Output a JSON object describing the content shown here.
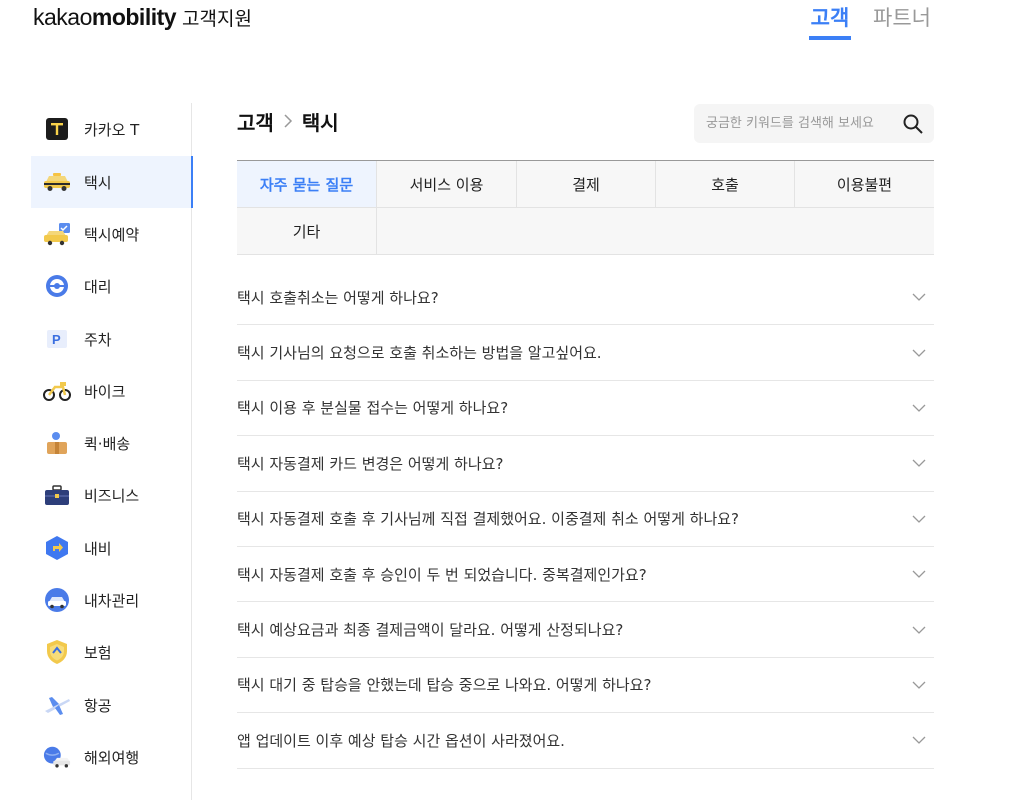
{
  "header": {
    "logo_kakao": "kakao",
    "logo_mobility": "mobility",
    "logo_support": "고객지원",
    "tabs": [
      {
        "label": "고객",
        "active": true
      },
      {
        "label": "파트너",
        "active": false
      }
    ]
  },
  "sidebar": {
    "items": [
      {
        "label": "카카오 T",
        "icon": "kakao-t-icon"
      },
      {
        "label": "택시",
        "icon": "taxi-icon",
        "active": true
      },
      {
        "label": "택시예약",
        "icon": "taxi-reservation-icon"
      },
      {
        "label": "대리",
        "icon": "designated-driver-icon"
      },
      {
        "label": "주차",
        "icon": "parking-icon"
      },
      {
        "label": "바이크",
        "icon": "bike-icon"
      },
      {
        "label": "퀵·배송",
        "icon": "quick-delivery-icon"
      },
      {
        "label": "비즈니스",
        "icon": "business-icon"
      },
      {
        "label": "내비",
        "icon": "navi-icon"
      },
      {
        "label": "내차관리",
        "icon": "car-management-icon"
      },
      {
        "label": "보험",
        "icon": "insurance-icon"
      },
      {
        "label": "항공",
        "icon": "flight-icon"
      },
      {
        "label": "해외여행",
        "icon": "overseas-travel-icon"
      }
    ]
  },
  "breadcrumb": {
    "items": [
      "고객",
      "택시"
    ]
  },
  "search": {
    "placeholder": "궁금한 키워드를 검색해 보세요",
    "value": ""
  },
  "category_tabs": [
    {
      "label": "자주 묻는 질문",
      "active": true
    },
    {
      "label": "서비스 이용"
    },
    {
      "label": "결제"
    },
    {
      "label": "호출"
    },
    {
      "label": "이용불편"
    },
    {
      "label": "기타"
    }
  ],
  "faq": [
    "택시 호출취소는 어떻게 하나요?",
    "택시 기사님의 요청으로 호출 취소하는 방법을 알고싶어요.",
    "택시 이용 후 분실물 접수는 어떻게 하나요?",
    "택시 자동결제 카드 변경은 어떻게 하나요?",
    "택시 자동결제 호출 후 기사님께 직접 결제했어요. 이중결제 취소 어떻게 하나요?",
    "택시 자동결제 호출 후 승인이 두 번 되었습니다. 중복결제인가요?",
    "택시 예상요금과 최종 결제금액이 달라요. 어떻게 산정되나요?",
    "택시 대기 중 탑승을 안했는데 탑승 중으로 나와요. 어떻게 하나요?",
    "앱 업데이트 이후 예상 탑승 시간 옵션이 사라졌어요."
  ],
  "colors": {
    "accent": "#3b7ff6",
    "active_bg": "#eef4fe",
    "tab_bg": "#f7f7f7"
  }
}
